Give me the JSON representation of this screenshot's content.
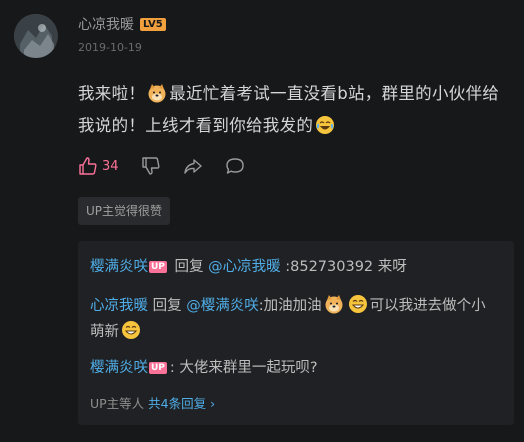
{
  "comment": {
    "username": "心凉我暖",
    "level_badge": "LV5",
    "date": "2019-10-19",
    "text_part1": "我来啦！",
    "text_part2": "最近忙着考试一直没看b站，群里的小伙伴给我说的！上线才看到你给我发的",
    "like_count": "34",
    "up_liked_label": "UP主觉得很赞"
  },
  "replies": [
    {
      "author": "樱满炎咲",
      "badge": "UP",
      "verb": "回复",
      "mention": "@心凉我暖",
      "text": ":852730392 来呀"
    },
    {
      "author": "心凉我暖",
      "verb": "回复",
      "mention": "@樱满炎咲",
      "text_part1": ":加油加油",
      "text_part2": "可以我进去做个小萌新"
    },
    {
      "author": "樱满炎咲",
      "badge": "UP",
      "text": ": 大佬来群里一起玩呗?"
    }
  ],
  "more_replies": {
    "prefix": "UP主等人",
    "link": "共4条回复 ›"
  },
  "colors": {
    "background": "#17181a",
    "link_blue": "#4faee8",
    "pink": "#fb7299",
    "level_orange": "#f29f3d"
  },
  "icons": [
    "thumb-up-icon",
    "thumb-down-icon",
    "share-icon",
    "comment-icon",
    "doge-emoji",
    "laugh-cry-emoji",
    "grin-emoji"
  ]
}
